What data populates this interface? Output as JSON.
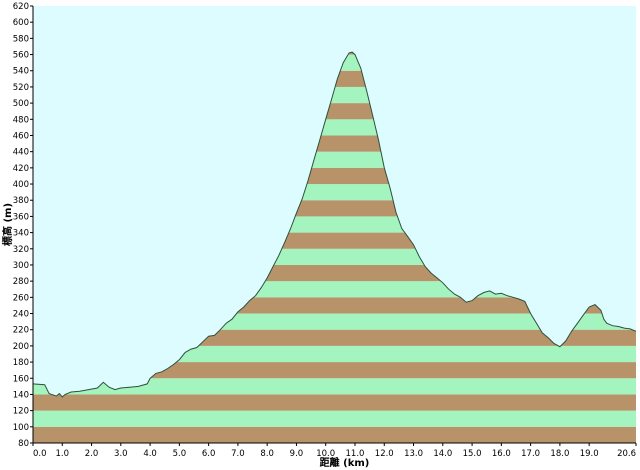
{
  "chart_data": {
    "type": "area",
    "xlabel": "距離 (km)",
    "ylabel": "標高 (m)",
    "xlim": [
      0,
      20.6
    ],
    "ylim": [
      80,
      620
    ],
    "x_ticks": [
      0,
      1,
      2,
      3,
      4,
      5,
      6,
      7,
      8,
      9,
      10,
      11,
      12,
      13,
      14,
      15,
      16,
      17,
      18,
      19,
      20.6
    ],
    "x_tick_labels": [
      "0.0",
      "1.0",
      "2.0",
      "3.0",
      "4.0",
      "5.0",
      "6.0",
      "7.0",
      "8.0",
      "9.0",
      "10.0",
      "11.0",
      "12.0",
      "13.0",
      "14.0",
      "15.0",
      "16.0",
      "17.0",
      "18.0",
      "19.0",
      "20.6"
    ],
    "y_ticks": [
      80,
      100,
      120,
      140,
      160,
      180,
      200,
      220,
      240,
      260,
      280,
      300,
      320,
      340,
      360,
      380,
      400,
      420,
      440,
      460,
      480,
      500,
      520,
      540,
      560,
      580,
      600,
      620
    ],
    "band_step": 20,
    "grid": false,
    "colors": {
      "background": "#dcfcff",
      "band_a": "#b8936a",
      "band_b": "#a4f4c0",
      "outline": "#2f4f3a",
      "axis": "#000000"
    },
    "series": [
      {
        "x": [
          0.0,
          0.4,
          0.55,
          0.8,
          0.9,
          1.0,
          1.1,
          1.3,
          1.6,
          1.9,
          2.2,
          2.4,
          2.6,
          2.8,
          3.0,
          3.3,
          3.6,
          3.9,
          4.0,
          4.2,
          4.4,
          4.6,
          4.8,
          5.0,
          5.2,
          5.4,
          5.6,
          5.8,
          6.0,
          6.2,
          6.4,
          6.6,
          6.8,
          7.0,
          7.2,
          7.4,
          7.6,
          7.8,
          8.0,
          8.2,
          8.4,
          8.6,
          8.8,
          9.0,
          9.2,
          9.4,
          9.6,
          9.8,
          10.0,
          10.2,
          10.4,
          10.6,
          10.8,
          10.9,
          11.0,
          11.2,
          11.4,
          11.6,
          11.8,
          12.0,
          12.2,
          12.4,
          12.6,
          12.8,
          13.0,
          13.2,
          13.4,
          13.6,
          13.8,
          14.0,
          14.2,
          14.4,
          14.6,
          14.8,
          15.0,
          15.2,
          15.4,
          15.6,
          15.8,
          16.0,
          16.2,
          16.4,
          16.6,
          16.8,
          17.0,
          17.2,
          17.4,
          17.6,
          17.8,
          18.0,
          18.2,
          18.4,
          18.6,
          18.8,
          19.0,
          19.2,
          19.4,
          19.5,
          19.6,
          19.8,
          20.0,
          20.2,
          20.4,
          20.6
        ],
        "y": [
          153,
          152,
          141,
          138,
          141,
          137,
          140,
          143,
          144,
          146,
          148,
          155,
          149,
          146,
          148,
          149,
          150,
          153,
          160,
          166,
          168,
          172,
          177,
          183,
          192,
          196,
          198,
          205,
          212,
          213,
          220,
          228,
          233,
          242,
          248,
          256,
          262,
          272,
          284,
          298,
          312,
          328,
          345,
          364,
          382,
          405,
          430,
          455,
          480,
          505,
          530,
          550,
          562,
          563,
          560,
          543,
          515,
          485,
          455,
          420,
          395,
          365,
          345,
          335,
          325,
          310,
          298,
          290,
          284,
          278,
          270,
          264,
          260,
          254,
          256,
          262,
          266,
          268,
          264,
          265,
          262,
          260,
          258,
          255,
          240,
          228,
          216,
          210,
          203,
          199,
          206,
          218,
          228,
          238,
          248,
          251,
          244,
          233,
          228,
          225,
          224,
          222,
          221,
          218
        ]
      }
    ]
  }
}
